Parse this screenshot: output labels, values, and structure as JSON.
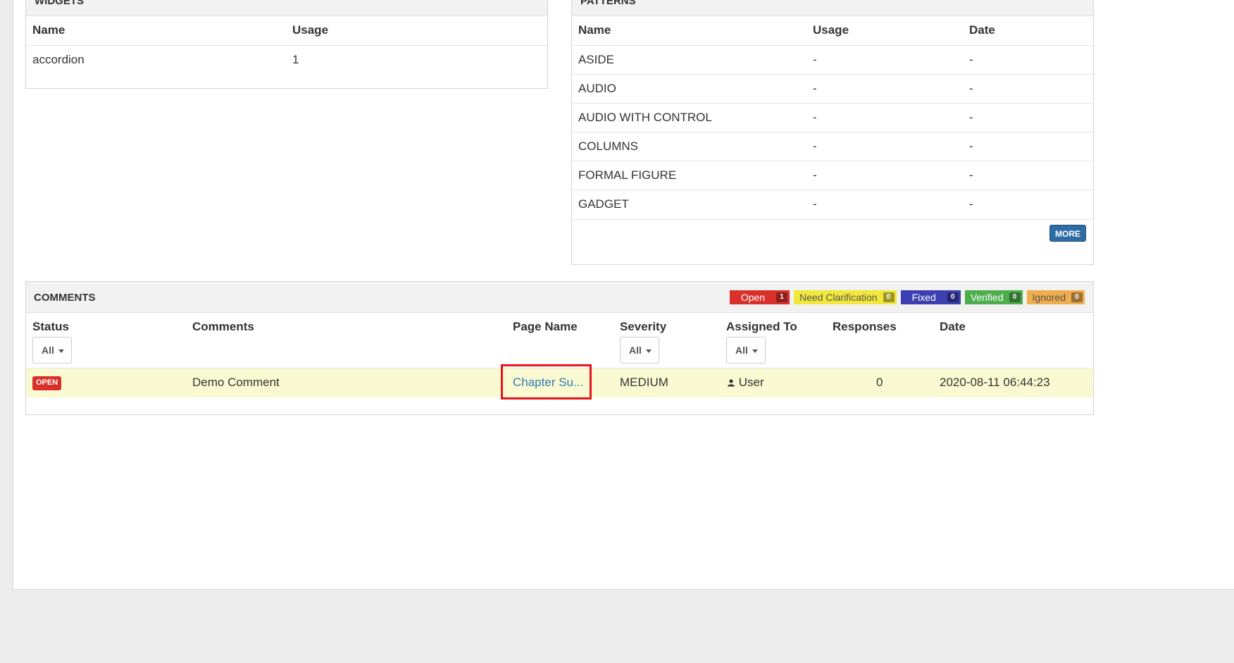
{
  "widgets": {
    "title": "WIDGETS",
    "columns": [
      "Name",
      "Usage"
    ],
    "rows": [
      {
        "name": "accordion",
        "usage": "1"
      }
    ]
  },
  "patterns": {
    "title": "PATTERNS",
    "columns": [
      "Name",
      "Usage",
      "Date"
    ],
    "rows": [
      {
        "name": "ASIDE",
        "usage": "-",
        "date": "-"
      },
      {
        "name": "AUDIO",
        "usage": "-",
        "date": "-"
      },
      {
        "name": "AUDIO WITH CONTROL",
        "usage": "-",
        "date": "-"
      },
      {
        "name": "COLUMNS",
        "usage": "-",
        "date": "-"
      },
      {
        "name": "FORMAL FIGURE",
        "usage": "-",
        "date": "-"
      },
      {
        "name": "GADGET",
        "usage": "-",
        "date": "-"
      }
    ],
    "more_label": "MORE"
  },
  "comments": {
    "title": "COMMENTS",
    "legend": [
      {
        "label": "Open",
        "count": "1",
        "color": "#d9302b",
        "text_color": "#ffffff"
      },
      {
        "label": "Need Clarification",
        "count": "0",
        "color": "#f3e73b",
        "text_color": "#555555"
      },
      {
        "label": "Fixed",
        "count": "0",
        "color": "#3b3fb0",
        "text_color": "#ffffff"
      },
      {
        "label": "Verified",
        "count": "0",
        "color": "#4cae4c",
        "text_color": "#ffffff"
      },
      {
        "label": "Ignored",
        "count": "0",
        "color": "#f0ad4e",
        "text_color": "#555555"
      }
    ],
    "columns": {
      "status": "Status",
      "comments": "Comments",
      "page_name": "Page Name",
      "severity": "Severity",
      "assigned_to": "Assigned To",
      "responses": "Responses",
      "date": "Date"
    },
    "filters": {
      "status": "All",
      "severity": "All",
      "assigned_to": "All"
    },
    "rows": [
      {
        "status": "OPEN",
        "comment": "Demo Comment",
        "page_name": "Chapter Su...",
        "severity": "MEDIUM",
        "assigned_to": "User",
        "responses": "0",
        "date": "2020-08-11 06:44:23"
      }
    ]
  }
}
